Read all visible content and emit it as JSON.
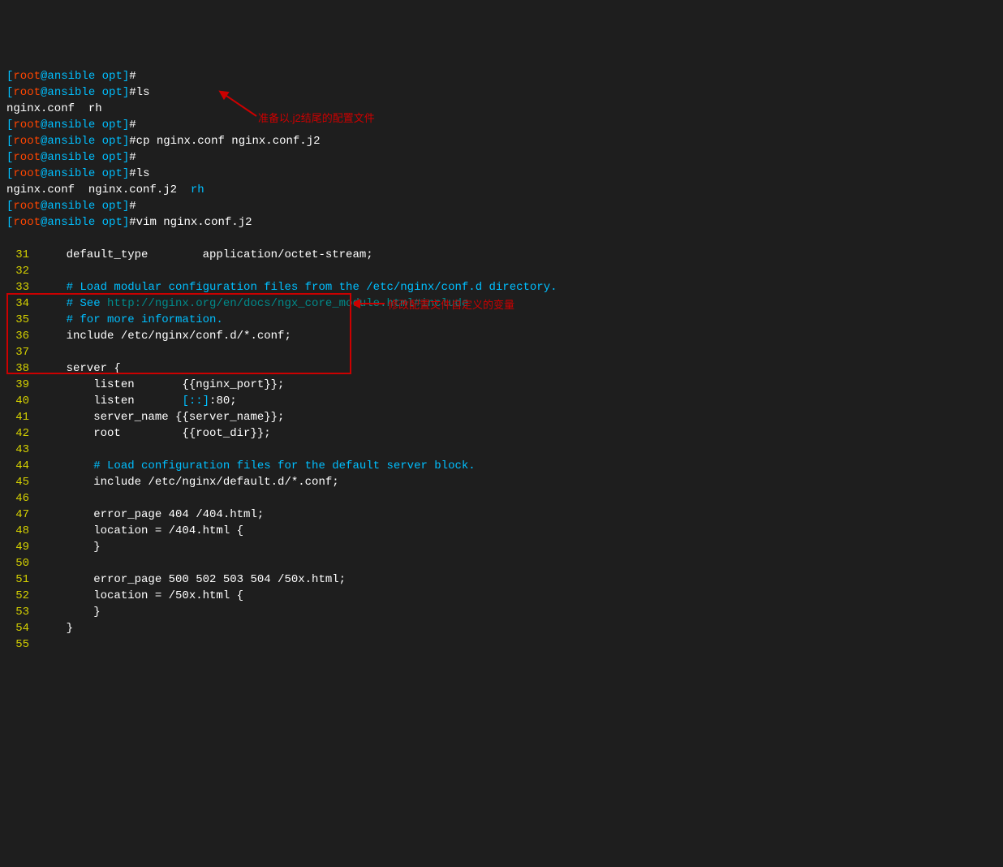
{
  "terminal": {
    "prompt": {
      "user": "root",
      "host": "ansible",
      "path": "opt"
    },
    "commands": [
      {
        "cmd": ""
      },
      {
        "cmd": "ls"
      },
      {
        "output": "nginx.conf  rh"
      },
      {
        "cmd": ""
      },
      {
        "cmd": "cp nginx.conf nginx.conf.j2"
      },
      {
        "cmd": ""
      },
      {
        "cmd": "ls"
      },
      {
        "output_parts": [
          "nginx.conf  nginx.conf.j2  ",
          "rh"
        ]
      },
      {
        "cmd": ""
      },
      {
        "cmd": "vim nginx.conf.j2"
      }
    ]
  },
  "editor": {
    "lines": [
      {
        "num": "31",
        "content": "    default_type        application/octet-stream;"
      },
      {
        "num": "32",
        "content": ""
      },
      {
        "num": "33",
        "content": "    # Load modular configuration files from the /etc/nginx/conf.d directory.",
        "color": "cyan"
      },
      {
        "num": "34",
        "content_parts": [
          {
            "t": "    # See ",
            "c": "cyan"
          },
          {
            "t": "http://nginx.org/en/docs/ngx_core_module.html#include",
            "c": "darkcyan"
          }
        ]
      },
      {
        "num": "35",
        "content": "    # for more information.",
        "color": "cyan"
      },
      {
        "num": "36",
        "content": "    include /etc/nginx/conf.d/*.conf;"
      },
      {
        "num": "37",
        "content": ""
      },
      {
        "num": "38",
        "content": "    server {"
      },
      {
        "num": "39",
        "content": "        listen       {{nginx_port}};"
      },
      {
        "num": "40",
        "content_parts": [
          {
            "t": "        listen       ",
            "c": "white"
          },
          {
            "t": "[::]",
            "c": "cyan"
          },
          {
            "t": ":80;",
            "c": "white"
          }
        ]
      },
      {
        "num": "41",
        "content": "        server_name {{server_name}};"
      },
      {
        "num": "42",
        "content": "        root         {{root_dir}};"
      },
      {
        "num": "43",
        "content": ""
      },
      {
        "num": "44",
        "content": "        # Load configuration files for the default server block.",
        "color": "cyan"
      },
      {
        "num": "45",
        "content": "        include /etc/nginx/default.d/*.conf;"
      },
      {
        "num": "46",
        "content": ""
      },
      {
        "num": "47",
        "content": "        error_page 404 /404.html;"
      },
      {
        "num": "48",
        "content": "        location = /404.html {"
      },
      {
        "num": "49",
        "content": "        }"
      },
      {
        "num": "50",
        "content": ""
      },
      {
        "num": "51",
        "content": "        error_page 500 502 503 504 /50x.html;"
      },
      {
        "num": "52",
        "content": "        location = /50x.html {"
      },
      {
        "num": "53",
        "content": "        }"
      },
      {
        "num": "54",
        "content": "    }"
      },
      {
        "num": "55",
        "content": ""
      }
    ]
  },
  "annotations": {
    "a1": "准备以.j2结尾的配置文件",
    "a2": "修改配置文件自定义的变量"
  }
}
